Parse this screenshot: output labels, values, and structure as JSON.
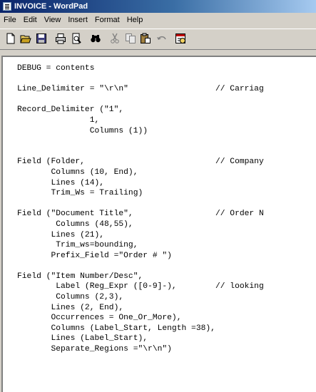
{
  "window": {
    "title": "INVOICE - WordPad"
  },
  "menu": {
    "items": [
      "File",
      "Edit",
      "View",
      "Insert",
      "Format",
      "Help"
    ]
  },
  "toolbar": {
    "buttons": [
      "new-icon",
      "open-icon",
      "save-icon",
      "print-icon",
      "print-preview-icon",
      "find-icon",
      "cut-icon",
      "copy-icon",
      "paste-icon",
      "undo-icon",
      "date-time-icon"
    ]
  },
  "document": {
    "lines": [
      "DEBUG = contents",
      "",
      "Line_Delimiter = \"\\r\\n\"                  // Carriag",
      "",
      "Record_Delimiter (\"1\",",
      "               1,",
      "               Columns (1))",
      "",
      "",
      "Field (Folder,                           // Company",
      "       Columns (10, End),",
      "       Lines (14),",
      "       Trim_Ws = Trailing)",
      "",
      "Field (\"Document Title\",                 // Order N",
      "        Columns (48,55),",
      "       Lines (21),",
      "        Trim_ws=bounding,",
      "       Prefix_Field =\"Order # \")",
      "",
      "Field (\"Item Number/Desc\",",
      "        Label (Reg_Expr ([0-9]-),        // looking",
      "        Columns (2,3),",
      "       Lines (2, End),",
      "       Occurrences = One_Or_More),",
      "       Columns (Label_Start, Length =38),",
      "       Lines (Label_Start),",
      "       Separate_Regions =\"\\r\\n\")"
    ]
  }
}
